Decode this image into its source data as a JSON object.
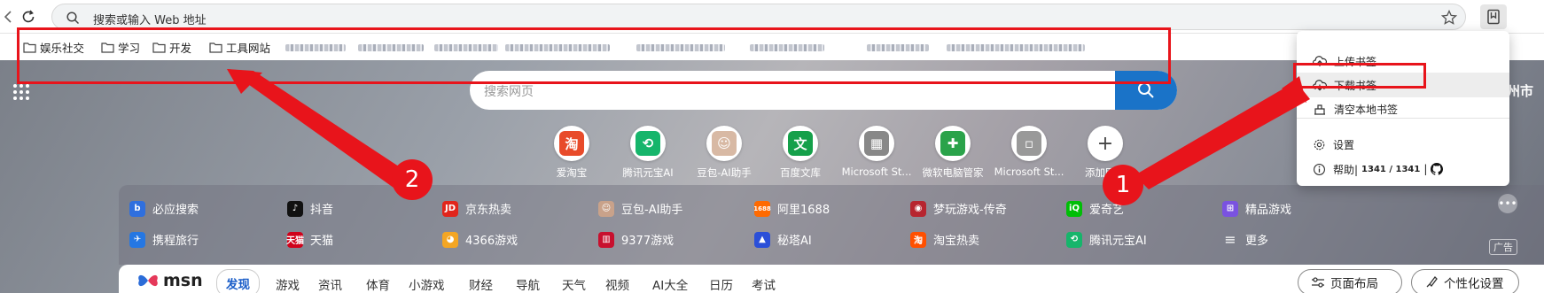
{
  "address_bar": {
    "placeholder": "搜索或输入 Web 地址"
  },
  "bookmarks": [
    {
      "label": "娱乐社交"
    },
    {
      "label": "学习"
    },
    {
      "label": "开发"
    },
    {
      "label": "工具网站"
    }
  ],
  "search": {
    "placeholder": "搜索网页"
  },
  "city_partial": "州市",
  "tiles": [
    {
      "label": "爱淘宝",
      "icon": "taobao-icon",
      "glyph": "淘",
      "color": "#e84b2a"
    },
    {
      "label": "腾讯元宝AI",
      "icon": "yuanbao-icon",
      "glyph": "⟲",
      "color": "#16b56b"
    },
    {
      "label": "豆包-AI助手",
      "icon": "doubao-icon",
      "glyph": "☺",
      "color": "#d8b9a4"
    },
    {
      "label": "百度文库",
      "icon": "baidu-wenku-icon",
      "glyph": "文",
      "color": "#15a04a"
    },
    {
      "label": "Microsoft St...",
      "icon": "microsoft-store-icon",
      "glyph": "▦",
      "color": "#888888"
    },
    {
      "label": "微软电脑管家",
      "icon": "pc-manager-icon",
      "glyph": "✚",
      "color": "#2aa34a"
    },
    {
      "label": "Microsoft St...",
      "icon": "broken-image-icon",
      "glyph": "▫",
      "color": "#999999"
    },
    {
      "label": "添加网站",
      "icon": "add-site-icon",
      "glyph": "+",
      "color": "#444444"
    }
  ],
  "quick_links_row1": [
    {
      "label": "必应搜索",
      "icon": "bing-icon",
      "glyph": "b",
      "color": "#2f6fde"
    },
    {
      "label": "抖音",
      "icon": "douyin-icon",
      "glyph": "♪",
      "color": "#111111"
    },
    {
      "label": "京东热卖",
      "icon": "jd-icon",
      "glyph": "JD",
      "color": "#e1251b"
    },
    {
      "label": "豆包-AI助手",
      "icon": "doubao-icon",
      "glyph": "☺",
      "color": "#c9a28a"
    },
    {
      "label": "阿里1688",
      "icon": "alibaba1688-icon",
      "glyph": "1688",
      "color": "#ff6a00"
    },
    {
      "label": "梦玩游戏-传奇",
      "icon": "game-icon",
      "glyph": "◉",
      "color": "#b7252f"
    },
    {
      "label": "爱奇艺",
      "icon": "iqiyi-icon",
      "glyph": "iQ",
      "color": "#00be06"
    },
    {
      "label": "精品游戏",
      "icon": "gamepad-icon",
      "glyph": "⊞",
      "color": "#7a52e0"
    }
  ],
  "quick_links_row2": [
    {
      "label": "携程旅行",
      "icon": "ctrip-icon",
      "glyph": "✈",
      "color": "#2577e3"
    },
    {
      "label": "天猫",
      "icon": "tmall-icon",
      "glyph": "天猫",
      "color": "#d0021b"
    },
    {
      "label": "4366游戏",
      "icon": "game4366-icon",
      "glyph": "◕",
      "color": "#f4a623"
    },
    {
      "label": "9377游戏",
      "icon": "game9377-icon",
      "glyph": "▥",
      "color": "#c8102e"
    },
    {
      "label": "秘塔AI",
      "icon": "metaso-icon",
      "glyph": "▲",
      "color": "#2b4fd8"
    },
    {
      "label": "淘宝热卖",
      "icon": "taobao-icon",
      "glyph": "淘",
      "color": "#ff5000"
    },
    {
      "label": "腾讯元宝AI",
      "icon": "yuanbao-icon",
      "glyph": "⟲",
      "color": "#16b56b"
    },
    {
      "label": "更多",
      "icon": "menu-icon",
      "glyph": "≡",
      "color": "transparent"
    }
  ],
  "ad_label": "广告",
  "msn": {
    "logo": "msn",
    "nav": [
      "发现",
      "游戏",
      "资讯",
      "体育",
      "小游戏",
      "财经",
      "导航",
      "天气",
      "视频",
      "AI大全",
      "日历",
      "考试"
    ],
    "layout_button": "页面布局",
    "personalize_button": "个性化设置"
  },
  "menu": {
    "items": [
      {
        "label": "上传书签",
        "icon": "cloud-upload-icon"
      },
      {
        "label": "下载书签",
        "icon": "cloud-download-icon"
      },
      {
        "label": "清空本地书签",
        "icon": "clear-bookmarks-icon"
      },
      {
        "label": "设置",
        "icon": "settings-icon"
      }
    ],
    "help_label": "帮助|",
    "help_count": "1341 / 1341",
    "help_sep": "|"
  },
  "annotations": {
    "badge1": "1",
    "badge2": "2"
  },
  "colors": {
    "accent": "#1a73c8",
    "annotation_red": "#e8141b"
  }
}
